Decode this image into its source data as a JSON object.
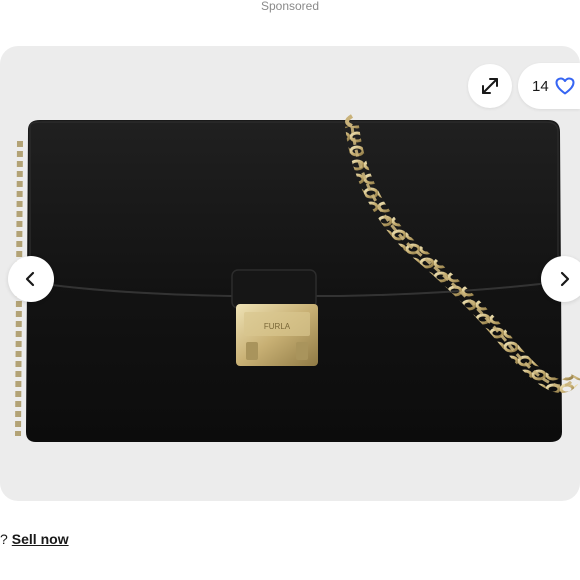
{
  "header": {
    "sponsored_label": "Sponsored"
  },
  "gallery": {
    "image_alt": "Black leather crossbody bag with gold chain strap and gold push-lock clasp",
    "icons": {
      "fullscreen": "expand-arrows-icon",
      "watch": "heart-icon",
      "prev": "chevron-left-icon",
      "next": "chevron-right-icon"
    },
    "watch_count": "14",
    "colors": {
      "background": "#ececec",
      "bag": "#141414",
      "hardware": "#c9b27a",
      "accent": "#3665f3"
    }
  },
  "footer": {
    "prompt_tail": "?",
    "sell_link": "Sell now"
  }
}
